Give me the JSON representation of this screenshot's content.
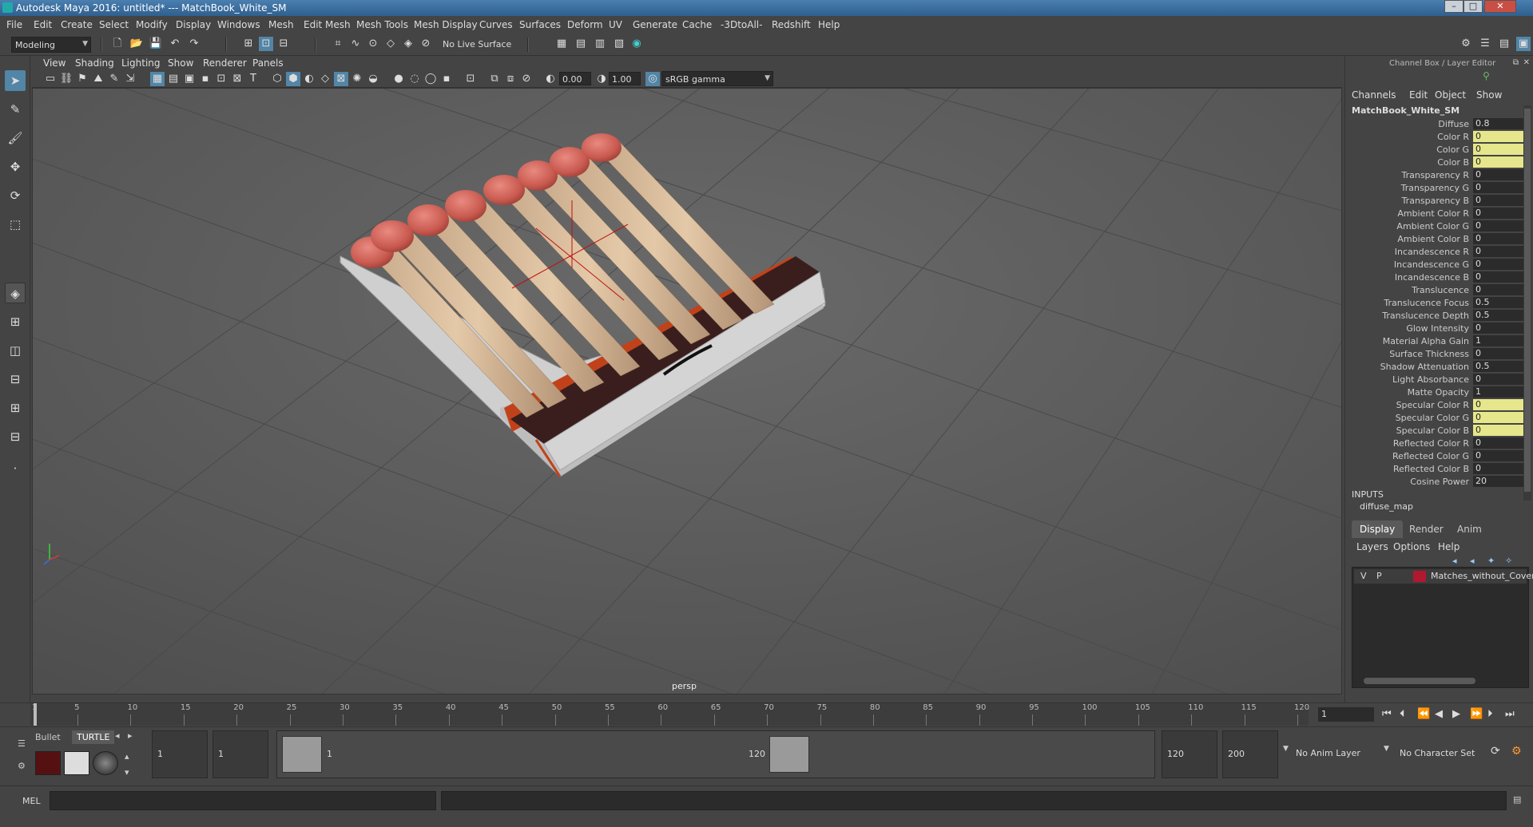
{
  "window": {
    "title": "Autodesk Maya 2016: untitled*   ---   MatchBook_White_SM",
    "minimize": "–",
    "maximize": "□",
    "close": "✕"
  },
  "menubar": [
    "File",
    "Edit",
    "Create",
    "Select",
    "Modify",
    "Display",
    "Windows",
    "Mesh",
    "Edit Mesh",
    "Mesh Tools",
    "Mesh Display",
    "Curves",
    "Surfaces",
    "Deform",
    "UV",
    "Generate",
    "Cache",
    "-3DtoAll-",
    "Redshift",
    "Help"
  ],
  "statusline": {
    "mode": "Modeling",
    "live_surface": "No Live Surface"
  },
  "viewport": {
    "menus": [
      "View",
      "Shading",
      "Lighting",
      "Show",
      "Renderer",
      "Panels"
    ],
    "exposure": "0.00",
    "gamma": "1.00",
    "color_space": "sRGB gamma",
    "camera_label": "persp"
  },
  "channel_box": {
    "panel_title": "Channel Box / Layer Editor",
    "menus": [
      "Channels",
      "Edit",
      "Object",
      "Show"
    ],
    "node": "MatchBook_White_SM",
    "attributes": [
      {
        "name": "Diffuse",
        "value": "0.8",
        "highlight": false
      },
      {
        "name": "Color R",
        "value": "0",
        "highlight": true
      },
      {
        "name": "Color G",
        "value": "0",
        "highlight": true
      },
      {
        "name": "Color B",
        "value": "0",
        "highlight": true
      },
      {
        "name": "Transparency R",
        "value": "0",
        "highlight": false
      },
      {
        "name": "Transparency G",
        "value": "0",
        "highlight": false
      },
      {
        "name": "Transparency B",
        "value": "0",
        "highlight": false
      },
      {
        "name": "Ambient Color R",
        "value": "0",
        "highlight": false
      },
      {
        "name": "Ambient Color G",
        "value": "0",
        "highlight": false
      },
      {
        "name": "Ambient Color B",
        "value": "0",
        "highlight": false
      },
      {
        "name": "Incandescence R",
        "value": "0",
        "highlight": false
      },
      {
        "name": "Incandescence G",
        "value": "0",
        "highlight": false
      },
      {
        "name": "Incandescence B",
        "value": "0",
        "highlight": false
      },
      {
        "name": "Translucence",
        "value": "0",
        "highlight": false
      },
      {
        "name": "Translucence Focus",
        "value": "0.5",
        "highlight": false
      },
      {
        "name": "Translucence Depth",
        "value": "0.5",
        "highlight": false
      },
      {
        "name": "Glow Intensity",
        "value": "0",
        "highlight": false
      },
      {
        "name": "Material Alpha Gain",
        "value": "1",
        "highlight": false
      },
      {
        "name": "Surface Thickness",
        "value": "0",
        "highlight": false
      },
      {
        "name": "Shadow Attenuation",
        "value": "0.5",
        "highlight": false
      },
      {
        "name": "Light Absorbance",
        "value": "0",
        "highlight": false
      },
      {
        "name": "Matte Opacity",
        "value": "1",
        "highlight": false
      },
      {
        "name": "Specular Color R",
        "value": "0",
        "highlight": true
      },
      {
        "name": "Specular Color G",
        "value": "0",
        "highlight": true
      },
      {
        "name": "Specular Color B",
        "value": "0",
        "highlight": true
      },
      {
        "name": "Reflected Color R",
        "value": "0",
        "highlight": false
      },
      {
        "name": "Reflected Color G",
        "value": "0",
        "highlight": false
      },
      {
        "name": "Reflected Color B",
        "value": "0",
        "highlight": false
      },
      {
        "name": "Cosine Power",
        "value": "20",
        "highlight": false
      }
    ],
    "inputs_header": "INPUTS",
    "inputs_item": "diffuse_map"
  },
  "layer_editor": {
    "tabs": [
      "Display",
      "Render",
      "Anim"
    ],
    "menus": [
      "Layers",
      "Options",
      "Help"
    ],
    "layer": {
      "v": "V",
      "p": "P",
      "name": "Matches_without_Cover",
      "color": "#b01830"
    }
  },
  "timeline": {
    "ticks": [
      "1",
      "5",
      "10",
      "15",
      "20",
      "25",
      "30",
      "35",
      "40",
      "45",
      "50",
      "55",
      "60",
      "65",
      "70",
      "75",
      "80",
      "85",
      "90",
      "95",
      "100",
      "105",
      "110",
      "115",
      "120"
    ],
    "current_frame": "1"
  },
  "range": {
    "shelf_tabs": [
      "Bullet",
      "TURTLE"
    ],
    "start_anim": "1",
    "start_range": "1",
    "range_start_label": "1",
    "range_end_label": "120",
    "end_range": "120",
    "end_anim": "200",
    "anim_layer": "No Anim Layer",
    "character_set": "No Character Set"
  },
  "command_line": {
    "language": "MEL"
  }
}
